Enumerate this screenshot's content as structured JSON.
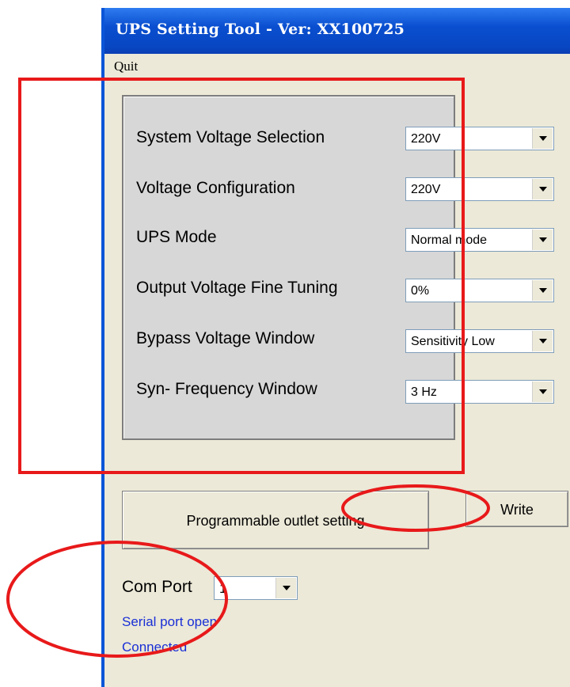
{
  "window": {
    "title": "UPS Setting Tool - Ver: XX100725"
  },
  "menu": {
    "quit": "Quit"
  },
  "settings": [
    {
      "label": "System Voltage Selection",
      "value": "220V"
    },
    {
      "label": "Voltage Configuration",
      "value": "220V"
    },
    {
      "label": "UPS Mode",
      "value": "Normal mode"
    },
    {
      "label": "Output Voltage Fine Tuning",
      "value": "0%"
    },
    {
      "label": "Bypass Voltage Window",
      "value": "Sensitivity Low"
    },
    {
      "label": "Syn- Frequency Window",
      "value": "3 Hz"
    }
  ],
  "buttons": {
    "outlet": "Programmable outlet setting",
    "write": "Write"
  },
  "com": {
    "label": "Com Port",
    "value": "1"
  },
  "status": {
    "line1": "Serial port open",
    "line2": "Connected"
  },
  "colors": {
    "title_bar": "#0a4fd0",
    "annotation": "#e8191a",
    "status_text": "#1a2fd6"
  }
}
